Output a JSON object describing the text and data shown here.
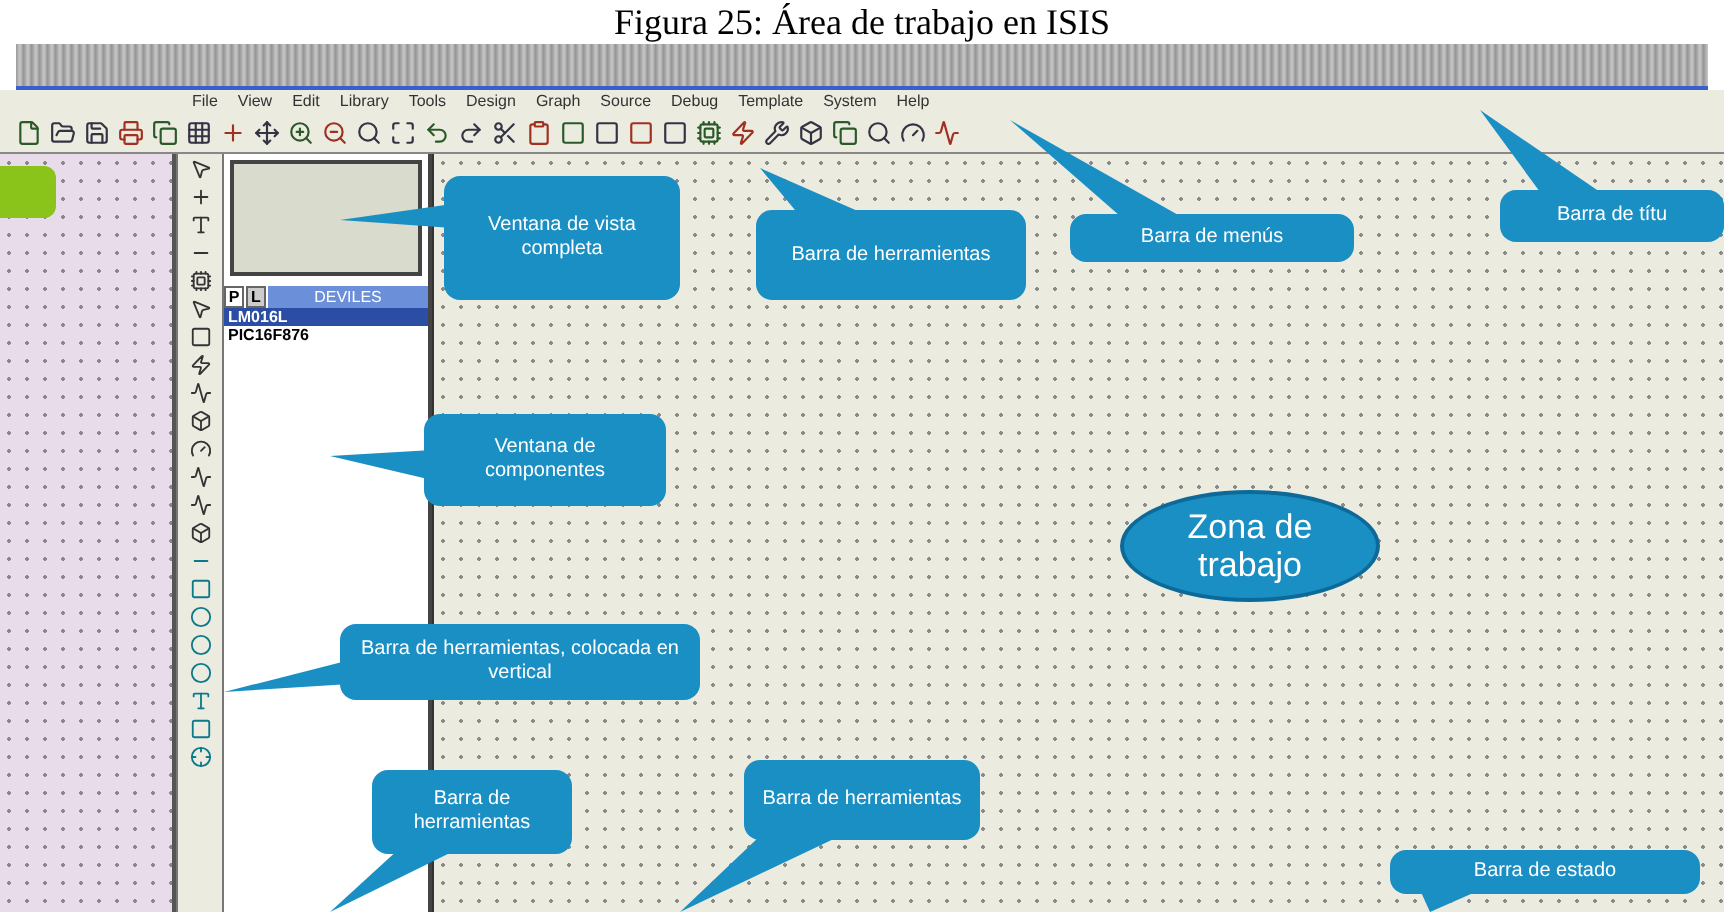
{
  "caption": "Figura 25: Área de trabajo en ISIS",
  "menu": [
    "File",
    "View",
    "Edit",
    "Library",
    "Tools",
    "Design",
    "Graph",
    "Source",
    "Debug",
    "Template",
    "System",
    "Help"
  ],
  "selector": {
    "tabs": [
      {
        "label": "P",
        "selected": true
      },
      {
        "label": "L",
        "selected": false
      }
    ],
    "header": "DEVILES",
    "devices": [
      {
        "name": "LM016L",
        "selected": true
      },
      {
        "name": "PIC16F876",
        "selected": false
      }
    ]
  },
  "callouts": [
    {
      "kind": "box",
      "text": "Ventana de vista completa"
    },
    {
      "kind": "box",
      "text": "Barra de herramientas"
    },
    {
      "kind": "box",
      "text": "Barra de menús"
    },
    {
      "kind": "box",
      "text": "Barra de títu"
    },
    {
      "kind": "box",
      "text": "Ventana de componentes"
    },
    {
      "kind": "ellipse",
      "text": "Zona de trabajo"
    },
    {
      "kind": "box",
      "text": "Barra de herramientas, colocada en vertical"
    },
    {
      "kind": "box",
      "text": "Barra de herramientas"
    },
    {
      "kind": "box",
      "text": "Barra de herramientas"
    },
    {
      "kind": "box",
      "text": "Barra de estado"
    }
  ]
}
